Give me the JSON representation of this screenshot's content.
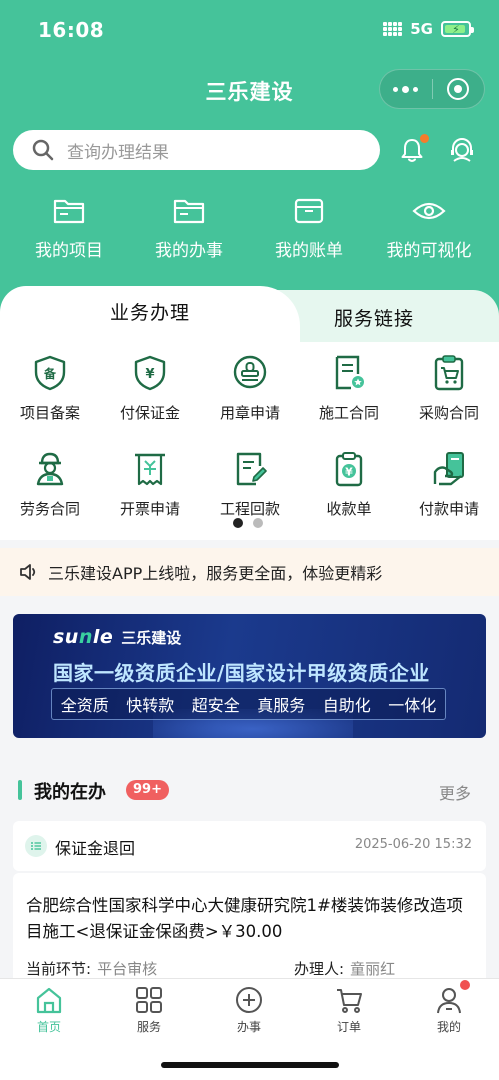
{
  "status": {
    "time": "16:08",
    "network": "5G"
  },
  "app": {
    "title": "三乐建设"
  },
  "search": {
    "placeholder": "查询办理结果"
  },
  "quick_links": [
    {
      "label": "我的项目",
      "icon": "folder-icon"
    },
    {
      "label": "我的办事",
      "icon": "folder-icon"
    },
    {
      "label": "我的账单",
      "icon": "bill-box-icon"
    },
    {
      "label": "我的可视化",
      "icon": "eye-icon"
    }
  ],
  "tabs": {
    "active": "业务办理",
    "inactive": "服务链接"
  },
  "services": [
    {
      "label": "项目备案",
      "icon": "shield-record-icon"
    },
    {
      "label": "付保证金",
      "icon": "shield-yen-icon"
    },
    {
      "label": "用章申请",
      "icon": "stamp-icon"
    },
    {
      "label": "施工合同",
      "icon": "contract-icon"
    },
    {
      "label": "采购合同",
      "icon": "cart-clipboard-icon"
    },
    {
      "label": "劳务合同",
      "icon": "worker-icon"
    },
    {
      "label": "开票申请",
      "icon": "invoice-icon"
    },
    {
      "label": "工程回款",
      "icon": "edit-document-icon"
    },
    {
      "label": "收款单",
      "icon": "receipt-yen-icon"
    },
    {
      "label": "付款申请",
      "icon": "payment-hand-icon"
    }
  ],
  "notice": {
    "text": "三乐建设APP上线啦，服务更全面，体验更精彩"
  },
  "banner": {
    "logo_mark_a": "su",
    "logo_mark_b": "n",
    "logo_mark_c": "le",
    "logo_text": "三乐建设",
    "headline": "国家一级资质企业/国家设计甲级资质企业",
    "chips": [
      "全资质",
      "快转款",
      "超安全",
      "真服务",
      "自助化",
      "一体化"
    ]
  },
  "todo": {
    "title": "我的在办",
    "badge": "99+",
    "more": "更多",
    "card_title": "保证金退回",
    "card_time": "2025-06-20 15:32",
    "body_text": "合肥综合性国家科学中心大健康研究院1#楼装饰装修改造项目施工<退保证金保函费>￥30.00",
    "stage_label": "当前环节:",
    "stage_value": "平台审核",
    "handler_label": "办理人:",
    "handler_value": "童丽红"
  },
  "tabbar": [
    {
      "label": "首页",
      "icon": "home-icon",
      "active": true
    },
    {
      "label": "服务",
      "icon": "grid-icon"
    },
    {
      "label": "办事",
      "icon": "plus-circle-icon"
    },
    {
      "label": "订单",
      "icon": "cart-icon"
    },
    {
      "label": "我的",
      "icon": "user-icon"
    }
  ],
  "colors": {
    "brand": "#45c39a",
    "badge": "#f06060",
    "notice_bg": "#fdf5ec",
    "banner": "#1b3a8d"
  }
}
